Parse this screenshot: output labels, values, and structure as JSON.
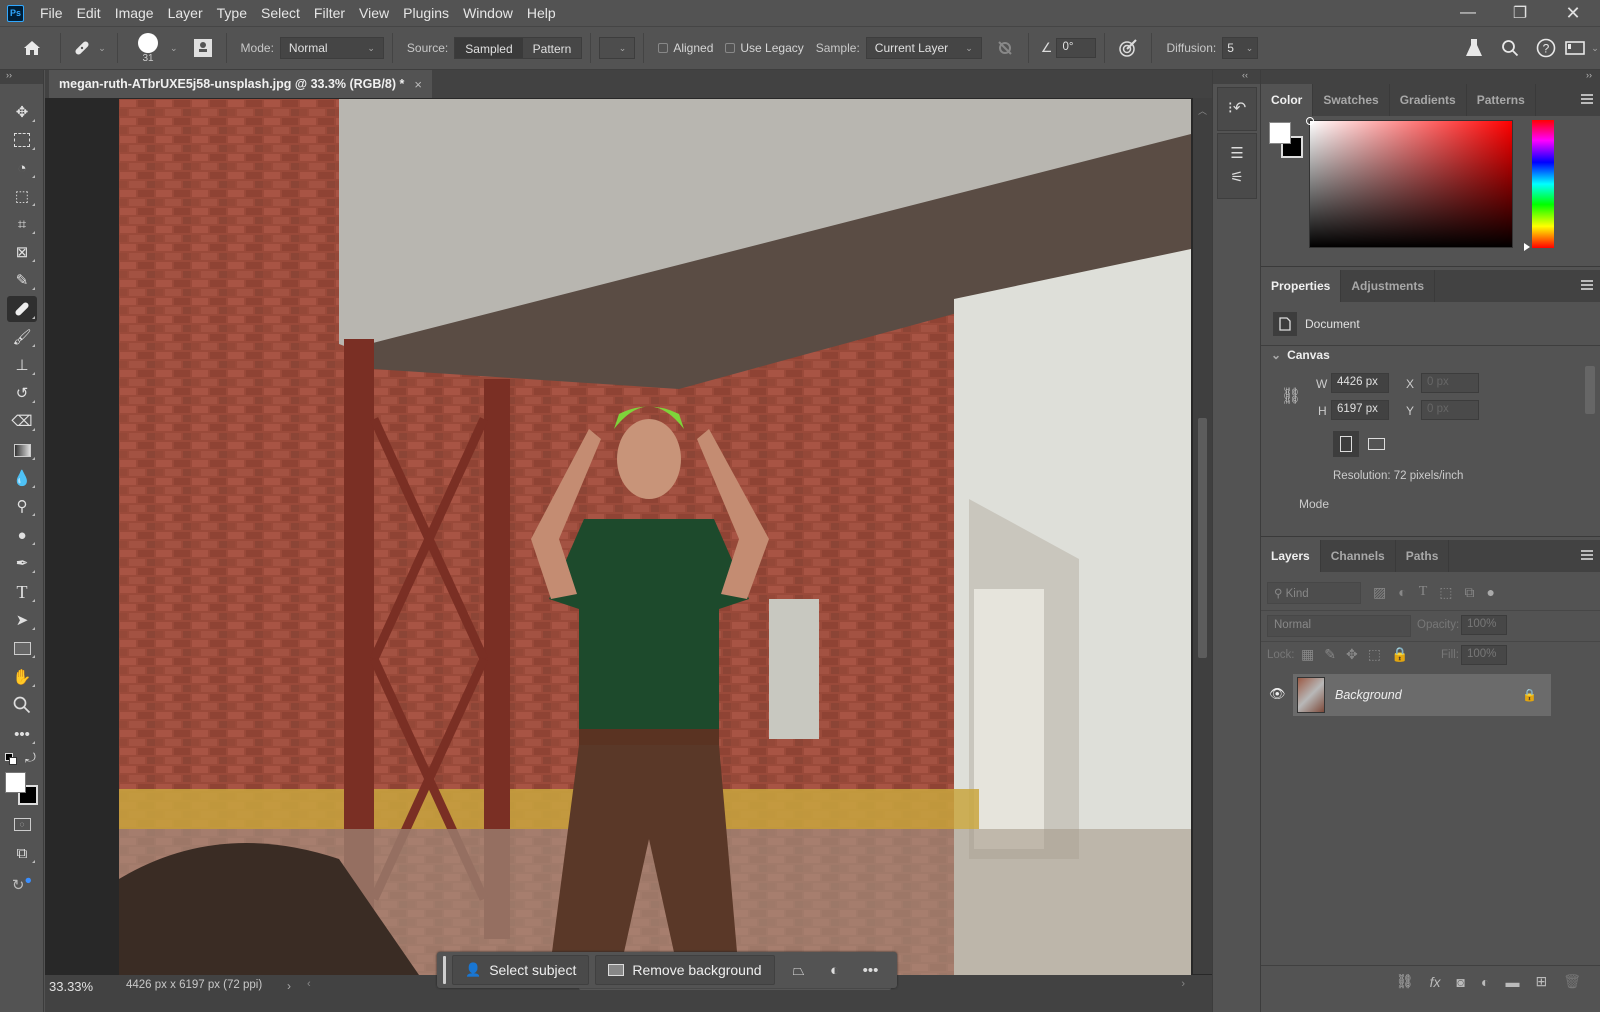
{
  "app": {
    "logo": "Ps"
  },
  "menu": [
    "File",
    "Edit",
    "Image",
    "Layer",
    "Type",
    "Select",
    "Filter",
    "View",
    "Plugins",
    "Window",
    "Help"
  ],
  "window_controls": {
    "minimize": "—",
    "restore": "❐",
    "close": "✕"
  },
  "options_bar": {
    "brush_size": "31",
    "mode_label": "Mode:",
    "mode_value": "Normal",
    "source_label": "Source:",
    "source_options": [
      "Sampled",
      "Pattern"
    ],
    "source_selected": "Sampled",
    "aligned_label": "Aligned",
    "aligned_checked": false,
    "use_legacy_label": "Use Legacy",
    "use_legacy_checked": false,
    "sample_label": "Sample:",
    "sample_value": "Current Layer",
    "angle_value": "0°",
    "diffusion_label": "Diffusion:",
    "diffusion_value": "5"
  },
  "document": {
    "tab_title": "megan-ruth-ATbrUXE5j58-unsplash.jpg @ 33.3% (RGB/8) *",
    "close": "×",
    "zoom_status": "33.33%",
    "doc_info": "4426 px x 6197 px (72 ppi)"
  },
  "contextual_taskbar": {
    "select_subject": "Select subject",
    "remove_background": "Remove background"
  },
  "color_panel": {
    "tabs": [
      "Color",
      "Swatches",
      "Gradients",
      "Patterns"
    ],
    "active_tab": "Color",
    "foreground": "#ffffff",
    "background": "#000000"
  },
  "properties_panel": {
    "tabs": [
      "Properties",
      "Adjustments"
    ],
    "active_tab": "Properties",
    "doc_label": "Document",
    "section": "Canvas",
    "w_label": "W",
    "w_value": "4426 px",
    "h_label": "H",
    "h_value": "6197 px",
    "x_label": "X",
    "x_placeholder": "0 px",
    "y_label": "Y",
    "y_placeholder": "0 px",
    "resolution": "Resolution: 72 pixels/inch",
    "mode_label": "Mode"
  },
  "layers_panel": {
    "tabs": [
      "Layers",
      "Channels",
      "Paths"
    ],
    "active_tab": "Layers",
    "filter_placeholder": "Kind",
    "blend_mode": "Normal",
    "opacity_label": "Opacity:",
    "opacity_value": "100%",
    "lock_label": "Lock:",
    "fill_label": "Fill:",
    "fill_value": "100%",
    "layers": [
      {
        "name": "Background",
        "visible": true,
        "locked": true
      }
    ]
  }
}
